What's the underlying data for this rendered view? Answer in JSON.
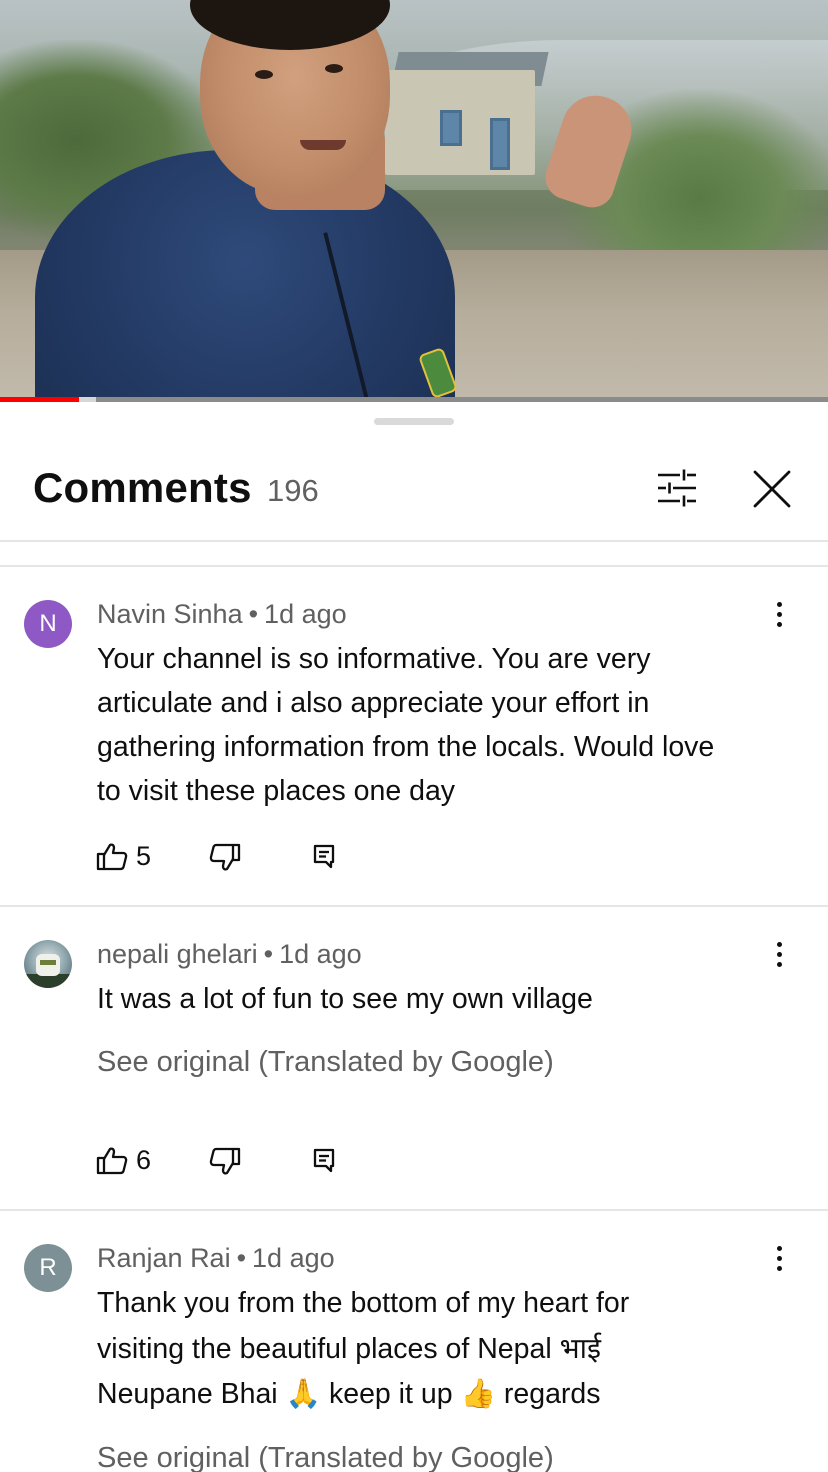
{
  "video": {
    "progress_fraction": 0.095,
    "buffer_fraction": 0.115
  },
  "sheet": {
    "title": "Comments",
    "count": "196"
  },
  "comments": [
    {
      "avatar_letter": "N",
      "avatar_color": "#8e59c4",
      "author": "Navin Sinha",
      "separator": "•",
      "time": "1d ago",
      "lines": [
        "Your channel is so informative. You are very",
        "articulate and i also appreciate your effort in",
        "gathering information from the locals. Would love",
        "to visit these places one day"
      ],
      "likes": "5"
    },
    {
      "avatar_letter": "",
      "author": "nepali ghelari",
      "separator": "•",
      "time": "1d ago",
      "lines": [
        "It was a lot of fun to see my own village"
      ],
      "see_original": "See original (Translated by Google)",
      "likes": "6"
    },
    {
      "avatar_letter": "R",
      "avatar_color": "#7d9096",
      "author": "Ranjan Rai",
      "separator": "•",
      "time": "1d ago",
      "lines": [
        "Thank you from the bottom of my heart for",
        "visiting the beautiful places of Nepal भाई",
        "Neupane Bhai 🙏 keep it up 👍 regards"
      ],
      "see_original": "See original (Translated by Google)"
    }
  ],
  "icons": {
    "filter": "sliders-icon",
    "close": "close-icon",
    "more": "more-vertical-icon",
    "like": "thumbs-up-icon",
    "dislike": "thumbs-down-icon",
    "reply": "reply-comment-icon"
  },
  "colors": {
    "progress": "#ff0000",
    "secondary_text": "#606060",
    "primary_text": "#0f0f0f",
    "divider": "#e5e5e5"
  }
}
